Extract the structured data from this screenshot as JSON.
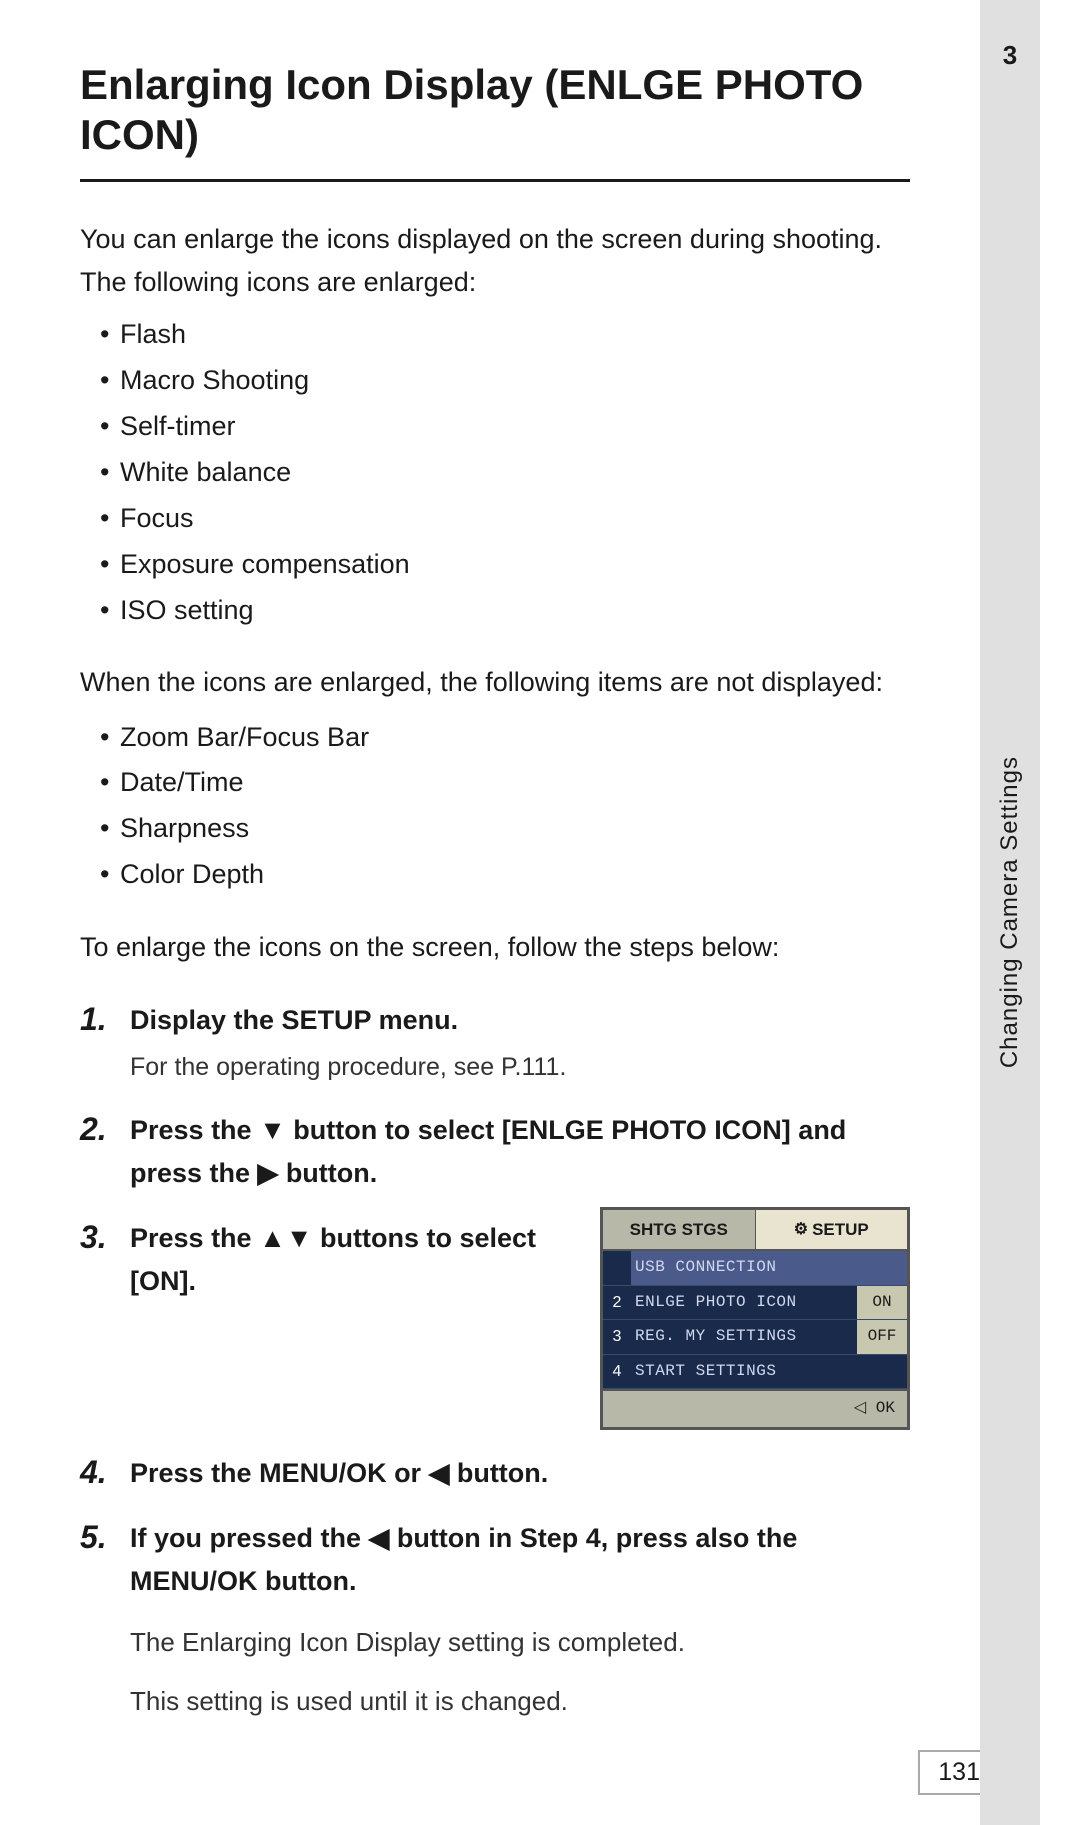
{
  "page": {
    "title": "Enlarging Icon Display (ENLGE PHOTO ICON)",
    "page_number": "131",
    "side_tab_label": "Changing Camera Settings",
    "side_tab_number": "3"
  },
  "intro": {
    "paragraph1": "You can enlarge the icons displayed on the screen during shooting. The following icons are enlarged:",
    "enlarged_icons": [
      "Flash",
      "Macro Shooting",
      "Self-timer",
      "White balance",
      "Focus",
      "Exposure compensation",
      "ISO setting"
    ],
    "paragraph2": "When the icons are enlarged, the following items are not displayed:",
    "not_displayed": [
      "Zoom Bar/Focus Bar",
      "Date/Time",
      "Sharpness",
      "Color Depth"
    ],
    "paragraph3": "To enlarge the icons on the screen, follow the steps below:"
  },
  "steps": [
    {
      "number": "1.",
      "main": "Display the SETUP menu.",
      "sub": "For the operating procedure, see P.111."
    },
    {
      "number": "2.",
      "main": "Press the ▼ button to select [ENLGE PHOTO ICON] and press the ▶ button."
    },
    {
      "number": "3.",
      "main": "Press the ▲▼ buttons to select [ON]."
    },
    {
      "number": "4.",
      "main": "Press the MENU/OK  or ◀ button."
    },
    {
      "number": "5.",
      "main": "If you pressed the ◀ button in Step 4, press also the MENU/OK button.",
      "after1": "The Enlarging Icon Display setting is completed.",
      "after2": "This setting is used until it is changed."
    }
  ],
  "camera_screen": {
    "tabs": [
      {
        "label": "SHTG STGS",
        "active": false
      },
      {
        "label": "SETUP",
        "active": true
      }
    ],
    "rows": [
      {
        "num": "",
        "label": "USB CONNECTION",
        "value": "",
        "highlight": true
      },
      {
        "num": "2",
        "label": "ENLGE PHOTO ICON",
        "value": "ON",
        "highlight": false
      },
      {
        "num": "3",
        "label": "REG. MY SETTINGS",
        "value": "OFF",
        "highlight": false
      },
      {
        "num": "4",
        "label": "START SETTINGS",
        "value": "",
        "highlight": false
      }
    ],
    "footer": "◁ OK"
  }
}
